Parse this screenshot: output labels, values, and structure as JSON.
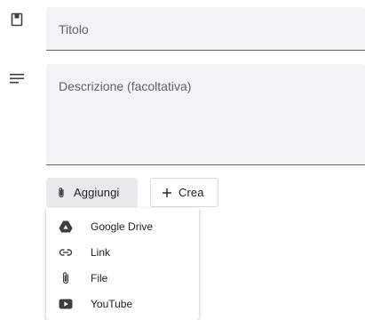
{
  "form": {
    "title_placeholder": "Titolo",
    "description_placeholder": "Descrizione (facoltativa)"
  },
  "actions": {
    "add_label": "Aggiungi",
    "create_label": "Crea"
  },
  "attach_menu": {
    "items": [
      {
        "label": "Google Drive",
        "icon": "google-drive-icon"
      },
      {
        "label": "Link",
        "icon": "link-icon"
      },
      {
        "label": "File",
        "icon": "paperclip-icon"
      },
      {
        "label": "YouTube",
        "icon": "youtube-icon"
      }
    ]
  },
  "colors": {
    "field_background": "#f1f3f4",
    "icon": "#5f6368",
    "text": "#202124"
  }
}
